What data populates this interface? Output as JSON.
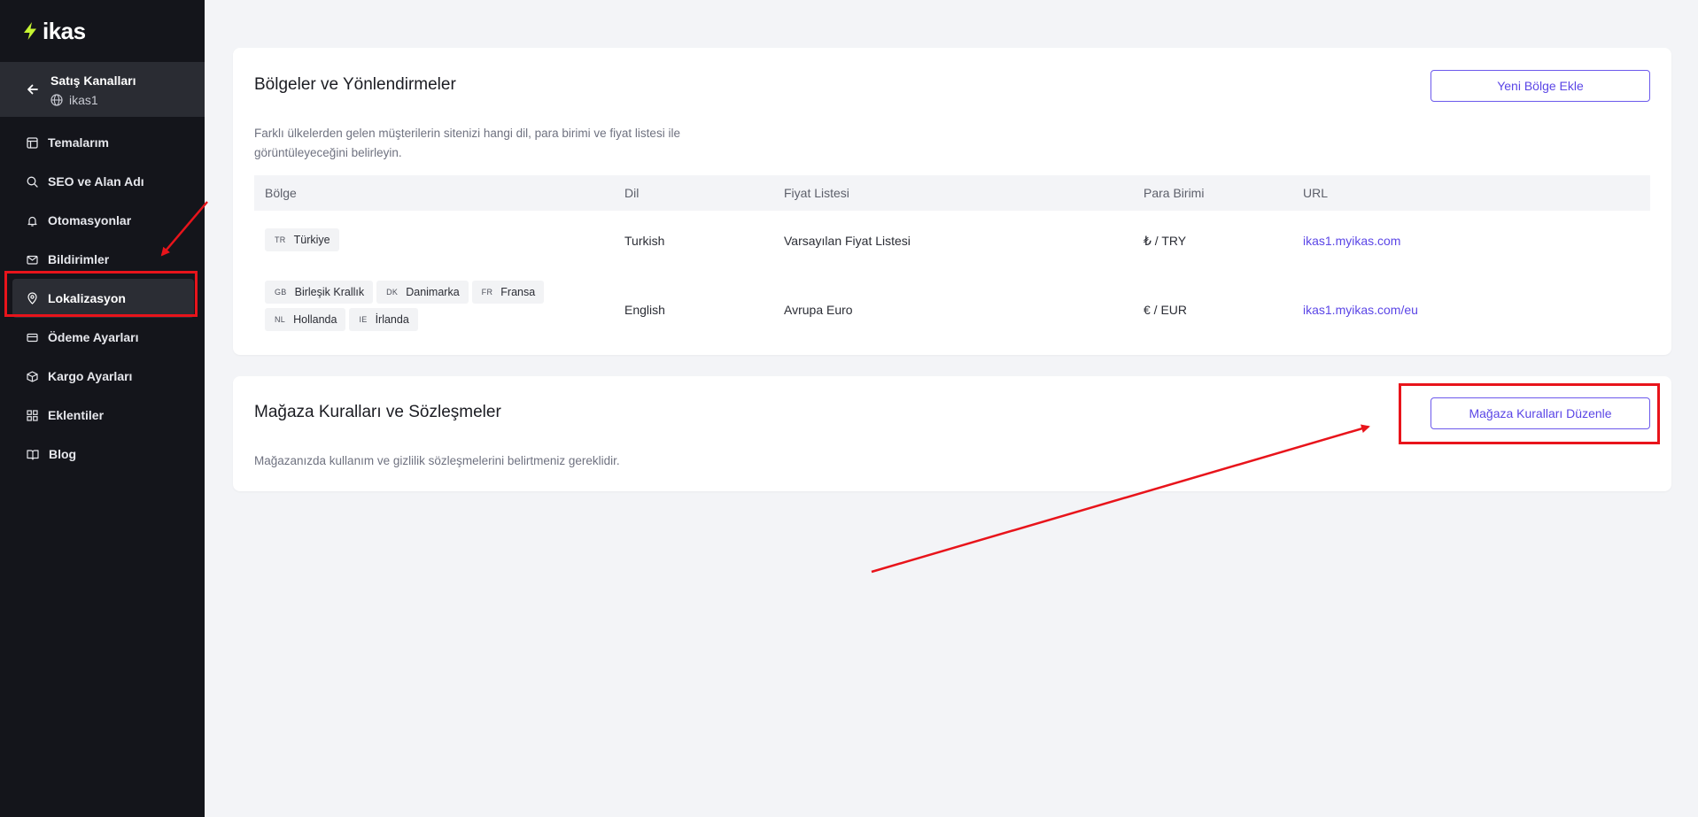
{
  "brand": {
    "name": "ikas",
    "accent": "#c6f432"
  },
  "sidebar": {
    "channel": {
      "title": "Satış Kanalları",
      "store": "ikas1"
    },
    "items": [
      {
        "label": "Temalarım",
        "icon": "layout-icon"
      },
      {
        "label": "SEO ve Alan Adı",
        "icon": "search-icon"
      },
      {
        "label": "Otomasyonlar",
        "icon": "bell-icon"
      },
      {
        "label": "Bildirimler",
        "icon": "mail-icon"
      },
      {
        "label": "Lokalizasyon",
        "icon": "map-pin-icon",
        "active": true
      },
      {
        "label": "Ödeme Ayarları",
        "icon": "credit-card-icon"
      },
      {
        "label": "Kargo Ayarları",
        "icon": "box-icon"
      },
      {
        "label": "Eklentiler",
        "icon": "grid-icon"
      },
      {
        "label": "Blog",
        "icon": "book-icon"
      }
    ]
  },
  "regions": {
    "title": "Bölgeler ve Yönlendirmeler",
    "add_button": "Yeni Bölge Ekle",
    "description": "Farklı ülkelerden gelen müşterilerin sitenizi hangi dil, para birimi ve fiyat listesi ile görüntüleyeceğini belirleyin.",
    "columns": [
      "Bölge",
      "Dil",
      "Fiyat Listesi",
      "Para Birimi",
      "URL"
    ],
    "rows": [
      {
        "countries": [
          {
            "code": "TR",
            "name": "Türkiye"
          }
        ],
        "language": "Turkish",
        "price_list": "Varsayılan Fiyat Listesi",
        "currency": "₺ / TRY",
        "url": "ikas1.myikas.com"
      },
      {
        "countries": [
          {
            "code": "GB",
            "name": "Birleşik Krallık"
          },
          {
            "code": "DK",
            "name": "Danimarka"
          },
          {
            "code": "FR",
            "name": "Fransa"
          },
          {
            "code": "NL",
            "name": "Hollanda"
          },
          {
            "code": "IE",
            "name": "İrlanda"
          }
        ],
        "language": "English",
        "price_list": "Avrupa Euro",
        "currency": "€ / EUR",
        "url": "ikas1.myikas.com/eu"
      }
    ]
  },
  "store_rules": {
    "title": "Mağaza Kuralları ve Sözleşmeler",
    "edit_button": "Mağaza Kuralları Düzenle",
    "description": "Mağazanızda kullanım ve gizlilik sözleşmelerini belirtmeniz gereklidir."
  },
  "colors": {
    "primary": "#5b46e6",
    "annotation": "#e8141b",
    "sidebar_bg": "#14151b"
  }
}
